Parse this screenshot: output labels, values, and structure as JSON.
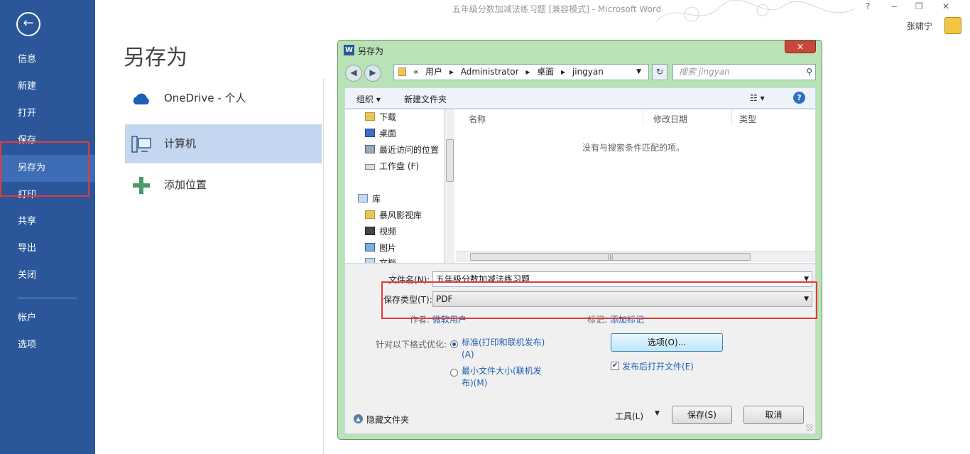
{
  "window": {
    "title": "五年级分数加减法练习题 [兼容模式] - Microsoft Word",
    "user_name": "张啸宁",
    "controls": [
      "?",
      "−",
      "❐",
      "✕"
    ]
  },
  "backstage": {
    "back_icon": "←",
    "items": [
      {
        "label": "信息"
      },
      {
        "label": "新建"
      },
      {
        "label": "打开"
      },
      {
        "label": "保存"
      },
      {
        "label": "另存为"
      },
      {
        "label": "打印"
      },
      {
        "label": "共享"
      },
      {
        "label": "导出"
      },
      {
        "label": "关闭"
      },
      {
        "label": "帐户"
      },
      {
        "label": "选项"
      }
    ],
    "active": "另存为"
  },
  "save_as": {
    "title": "另存为",
    "locations": [
      {
        "label": "OneDrive - 个人",
        "icon": "cloud-icon"
      },
      {
        "label": "计算机",
        "icon": "computer-icon"
      },
      {
        "label": "添加位置",
        "icon": "plus-icon"
      }
    ]
  },
  "dialog": {
    "title": "另存为",
    "close": "✕",
    "breadcrumb": [
      "«",
      "用户",
      "▸",
      "Administrator",
      "▸",
      "桌面",
      "▸",
      "jingyan"
    ],
    "search_placeholder": "搜索 jingyan",
    "toolbar": {
      "organize": "组织 ▾",
      "new_folder": "新建文件夹",
      "view": "☷ ▾",
      "help": "?"
    },
    "tree": [
      {
        "label": "下载",
        "icon": "folder"
      },
      {
        "label": "桌面",
        "icon": "desk"
      },
      {
        "label": "最近访问的位置",
        "icon": "recent"
      },
      {
        "label": "工作盘 (F)",
        "icon": "drive"
      },
      {
        "label": "库",
        "icon": "lib"
      },
      {
        "label": "暴风影视库",
        "icon": "folder"
      },
      {
        "label": "视频",
        "icon": "video"
      },
      {
        "label": "图片",
        "icon": "pic"
      },
      {
        "label": "文档",
        "icon": "lib"
      }
    ],
    "columns": [
      "名称",
      "修改日期",
      "类型"
    ],
    "empty_message": "没有与搜索条件匹配的项。",
    "filename_label": "文件名(N):",
    "filename_value": "五年级分数加减法练习题",
    "type_label": "保存类型(T):",
    "type_value": "PDF",
    "author_label": "作者:",
    "author_value": "微软用户",
    "tags_label": "标记:",
    "tags_value": "添加标记",
    "optimize_label": "针对以下格式优化:",
    "options": [
      {
        "label_line1": "标准(打印和联机发布)",
        "label_line2": "(A)",
        "checked": true
      },
      {
        "label_line1": "最小文件大小(联机发",
        "label_line2": "布)(M)",
        "checked": false
      }
    ],
    "options_button": "选项(O)...",
    "open_after_publish": "发布后打开文件(E)",
    "hide_folders": "隐藏文件夹",
    "tools": "工具(L)",
    "save": "保存(S)",
    "cancel": "取消"
  },
  "colors": {
    "nav_bg": "#2b579a",
    "highlight": "#e03c3c",
    "dialog_frame": "#b9e3b7"
  }
}
